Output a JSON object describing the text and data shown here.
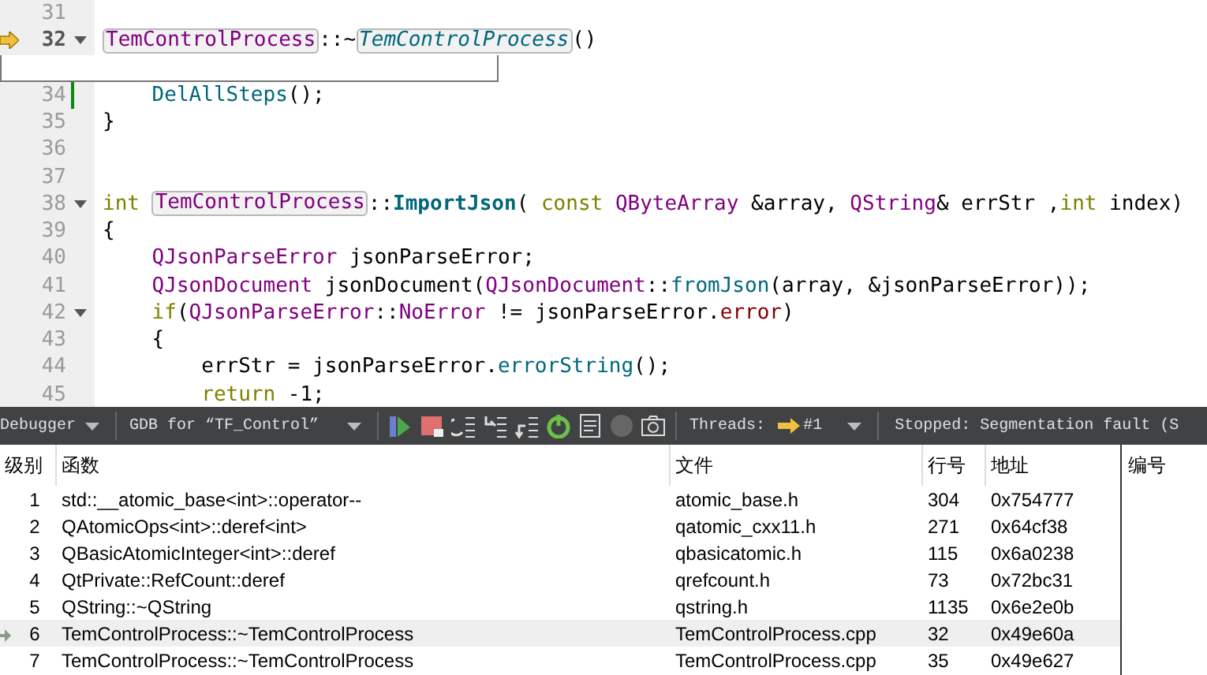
{
  "editor": {
    "lines": [
      {
        "number": "31",
        "current": false,
        "foldable": false,
        "modified": false
      },
      {
        "number": "32",
        "current": true,
        "foldable": true,
        "modified": false,
        "tokens": [
          {
            "text": "TemControlProcess",
            "kind": "ref"
          },
          {
            "text": "::~",
            "kind": "plain"
          },
          {
            "text": "TemControlProcess",
            "kind": "ref-italic"
          },
          {
            "text": "()",
            "kind": "plain"
          }
        ]
      },
      {
        "covered": true
      },
      {
        "number": "34",
        "current": false,
        "foldable": false,
        "modified": true,
        "tokens": [
          {
            "text": "    DelAllSteps",
            "kind": "func"
          },
          {
            "text": "();",
            "kind": "plain"
          }
        ]
      },
      {
        "number": "35",
        "current": false,
        "foldable": false,
        "modified": false,
        "tokens": [
          {
            "text": "}",
            "kind": "plain"
          }
        ]
      },
      {
        "number": "36",
        "current": false,
        "foldable": false,
        "modified": false
      },
      {
        "number": "37",
        "current": false,
        "foldable": false,
        "modified": false
      },
      {
        "number": "38",
        "current": false,
        "foldable": true,
        "modified": false,
        "tokens": [
          {
            "text": "int ",
            "kind": "keyword"
          },
          {
            "text": "TemControlProcess",
            "kind": "ref"
          },
          {
            "text": "::",
            "kind": "plain"
          },
          {
            "text": "ImportJson",
            "kind": "decl"
          },
          {
            "text": "( ",
            "kind": "plain"
          },
          {
            "text": "const ",
            "kind": "keyword"
          },
          {
            "text": "QByteArray",
            "kind": "type"
          },
          {
            "text": " &array, ",
            "kind": "plain"
          },
          {
            "text": "QString",
            "kind": "type"
          },
          {
            "text": "& errStr ,",
            "kind": "plain"
          },
          {
            "text": "int",
            "kind": "keyword"
          },
          {
            "text": " index)",
            "kind": "plain"
          }
        ]
      },
      {
        "number": "39",
        "current": false,
        "foldable": false,
        "modified": false,
        "tokens": [
          {
            "text": "{",
            "kind": "plain"
          }
        ]
      },
      {
        "number": "40",
        "current": false,
        "foldable": false,
        "modified": false,
        "tokens": [
          {
            "text": "    QJsonParseError",
            "kind": "type"
          },
          {
            "text": " jsonParseError;",
            "kind": "plain"
          }
        ]
      },
      {
        "number": "41",
        "current": false,
        "foldable": false,
        "modified": false,
        "tokens": [
          {
            "text": "    QJsonDocument",
            "kind": "type"
          },
          {
            "text": " jsonDocument(",
            "kind": "plain"
          },
          {
            "text": "QJsonDocument",
            "kind": "type"
          },
          {
            "text": "::",
            "kind": "plain"
          },
          {
            "text": "fromJson",
            "kind": "func"
          },
          {
            "text": "(array, &jsonParseError));",
            "kind": "plain"
          }
        ]
      },
      {
        "number": "42",
        "current": false,
        "foldable": true,
        "modified": false,
        "tokens": [
          {
            "text": "    if",
            "kind": "keyword"
          },
          {
            "text": "(",
            "kind": "plain"
          },
          {
            "text": "QJsonParseError",
            "kind": "type"
          },
          {
            "text": "::",
            "kind": "plain"
          },
          {
            "text": "NoError",
            "kind": "enum"
          },
          {
            "text": " != jsonParseError.",
            "kind": "plain"
          },
          {
            "text": "error",
            "kind": "member"
          },
          {
            "text": ")",
            "kind": "plain"
          }
        ]
      },
      {
        "number": "43",
        "current": false,
        "foldable": false,
        "modified": false,
        "tokens": [
          {
            "text": "    {",
            "kind": "plain"
          }
        ]
      },
      {
        "number": "44",
        "current": false,
        "foldable": false,
        "modified": false,
        "tokens": [
          {
            "text": "        errStr = jsonParseError.",
            "kind": "plain"
          },
          {
            "text": "errorString",
            "kind": "func"
          },
          {
            "text": "();",
            "kind": "plain"
          }
        ]
      },
      {
        "number": "45",
        "current": false,
        "foldable": false,
        "modified": false,
        "tokens": [
          {
            "text": "        return",
            "kind": "keyword"
          },
          {
            "text": " -1;",
            "kind": "plain"
          }
        ]
      }
    ]
  },
  "toolbar": {
    "mode": "Debugger",
    "engine": "GDB for “TF_Control”",
    "threads_label": "Threads:",
    "thread": "#1",
    "status": "Stopped: Segmentation fault (S"
  },
  "stack": {
    "columns": [
      "级别",
      "函数",
      "文件",
      "行号",
      "地址"
    ],
    "side_column": "编号",
    "rows": [
      {
        "level": "1",
        "function": "std::__atomic_base<int>::operator--",
        "file": "atomic_base.h",
        "line": "304",
        "address": "0x754777",
        "selected": false
      },
      {
        "level": "2",
        "function": "QAtomicOps<int>::deref<int>",
        "file": "qatomic_cxx11.h",
        "line": "271",
        "address": "0x64cf38",
        "selected": false
      },
      {
        "level": "3",
        "function": "QBasicAtomicInteger<int>::deref",
        "file": "qbasicatomic.h",
        "line": "115",
        "address": "0x6a0238",
        "selected": false
      },
      {
        "level": "4",
        "function": "QtPrivate::RefCount::deref",
        "file": "qrefcount.h",
        "line": "73",
        "address": "0x72bc31",
        "selected": false
      },
      {
        "level": "5",
        "function": "QString::~QString",
        "file": "qstring.h",
        "line": "1135",
        "address": "0x6e2e0b",
        "selected": false
      },
      {
        "level": "6",
        "function": "TemControlProcess::~TemControlProcess",
        "file": "TemControlProcess.cpp",
        "line": "32",
        "address": "0x49e60a",
        "selected": true
      },
      {
        "level": "7",
        "function": "TemControlProcess::~TemControlProcess",
        "file": "TemControlProcess.cpp",
        "line": "35",
        "address": "0x49e627",
        "selected": false
      }
    ]
  }
}
